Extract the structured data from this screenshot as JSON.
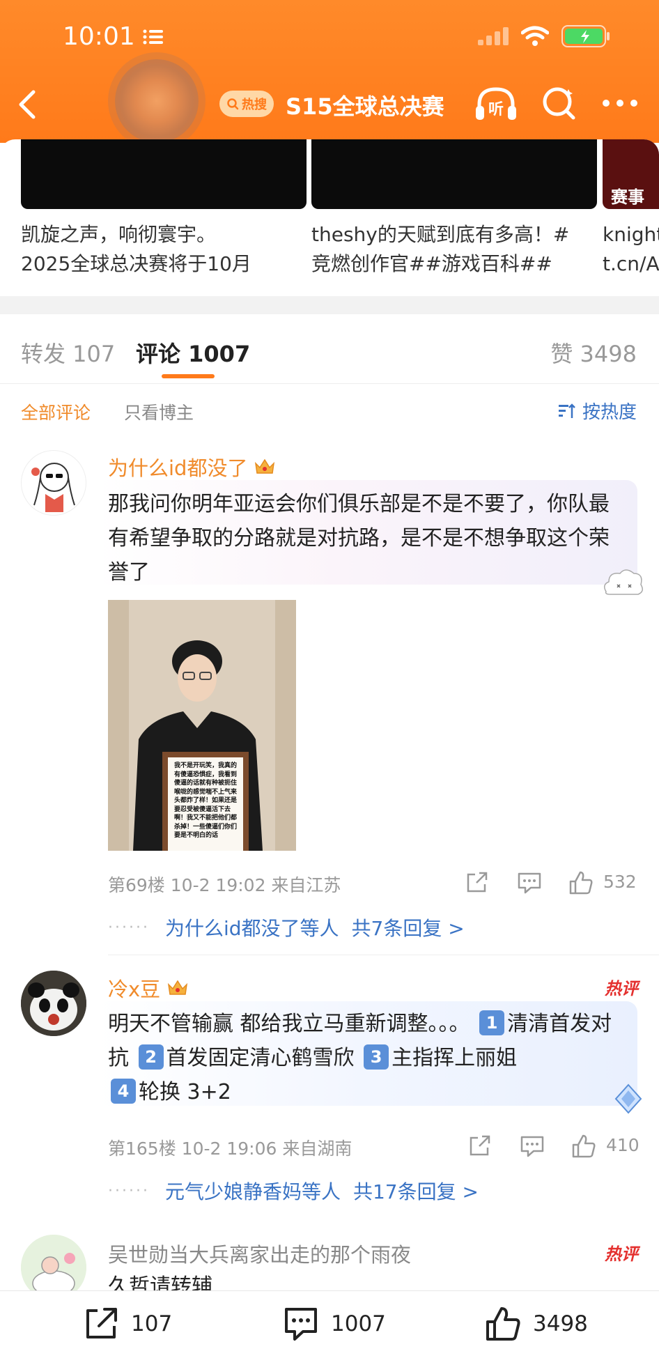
{
  "status_bar": {
    "time": "10:01"
  },
  "header": {
    "hot_label": "热搜",
    "title": "S15全球总决赛",
    "listen_label": "听"
  },
  "videos": [
    {
      "line1": "凯旋之声，响彻寰宇。",
      "line2": "2025全球总决赛将于10月"
    },
    {
      "line1": "theshy的天赋到底有多高！#",
      "line2": "竞燃创作官##游戏百科##"
    },
    {
      "line1": "knight",
      "line2": "t.cn/A",
      "thumb_text": "赛事"
    }
  ],
  "tabs": {
    "repost": "转发 107",
    "comments": "评论 1007",
    "likes": "赞 3498"
  },
  "filters": {
    "all": "全部评论",
    "author_only": "只看博主",
    "sort": "按热度"
  },
  "comments": [
    {
      "name": "为什么id都没了",
      "text": "那我问你明年亚运会你们俱乐部是不是不要了，你队最有希望争取的分路就是对抗路，是不是不想争取这个荣誉了",
      "sign_text": "我不是开玩笑，我真的有傻逼恐惧症，我看到傻逼的话就有种被扼住喉咙的感觉喘不上气来头都炸了样！如果还是要忍受被傻逼活下去啊！我又不能把他们都杀掉！一些傻逼们你们要是不明白的话",
      "meta": "第69楼 10-2 19:02 来自江苏",
      "likes": "532",
      "reply_by": "为什么id都没了等人",
      "reply_count": "共7条回复 >"
    },
    {
      "name": "冷x豆",
      "hot": "热评",
      "text_parts": [
        "明天不管输赢 都给我立马重新调整。。。",
        "清清首发对抗",
        "首发固定清心鹤雪欣",
        "主指挥上丽姐",
        "轮换 3+2"
      ],
      "badges": [
        "1",
        "2",
        "3",
        "4"
      ],
      "meta": "第165楼 10-2 19:06 来自湖南",
      "likes": "410",
      "reply_by": "元气少娘静香妈等人",
      "reply_count": "共17条回复 >"
    },
    {
      "name": "吴世勋当大兵离家出走的那个雨夜",
      "hot": "热评",
      "text": "久哲请转辅"
    }
  ],
  "bottom_bar": {
    "reposts": "107",
    "comments": "1007",
    "likes": "3498"
  },
  "colors": {
    "header": "#ff7a1a",
    "accent_orange": "#f08b2b",
    "link_blue": "#3a73c4",
    "hot_red": "#e4302e"
  }
}
